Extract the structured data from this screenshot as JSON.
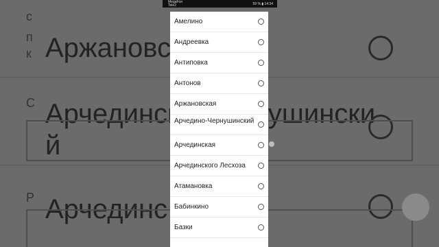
{
  "status_bar": {
    "carrier_line1": "MegaFon",
    "carrier_line2": "Tele2",
    "battery": "59 %",
    "time": "14:34"
  },
  "background": {
    "rows": [
      "Аржановс",
      "Арчединско-Чернушински",
      "й",
      "Арчединс"
    ]
  },
  "dialog": {
    "items": [
      {
        "label": "Амелино"
      },
      {
        "label": "Андреевка"
      },
      {
        "label": "Антиповка"
      },
      {
        "label": "Антонов"
      },
      {
        "label": "Аржановская"
      },
      {
        "label": "Арчедино-Чернушинский"
      },
      {
        "label": "Арчединская"
      },
      {
        "label": "Арчединского Лесхоза"
      },
      {
        "label": "Атамановка"
      },
      {
        "label": "Бабинкино"
      },
      {
        "label": "Базки"
      }
    ]
  }
}
